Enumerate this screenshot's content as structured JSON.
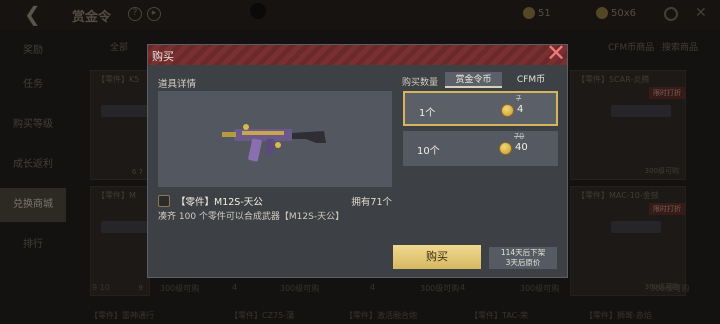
{
  "topbar": {
    "title": "赏金令",
    "currency1": "51",
    "currency2": "50x6"
  },
  "sidebar": {
    "items": [
      {
        "label": "奖励"
      },
      {
        "label": "任务"
      },
      {
        "label": "购买等级"
      },
      {
        "label": "成长返利"
      },
      {
        "label": "兑换商城"
      },
      {
        "label": "排行"
      }
    ]
  },
  "background": {
    "filters": [
      "全部",
      "CFM币商品",
      "搜索商品"
    ],
    "cards": [
      {
        "title": "【零件】K5",
        "price": "6 7"
      },
      {
        "title": "【零件】SCAR-炎腾",
        "limit": "限时打折",
        "price": "300级可购"
      },
      {
        "title": "【零件】M",
        "price": "9"
      },
      {
        "title": "【零件】MAC-10-金鼓",
        "limit": "限时打折",
        "price": "300级可购"
      }
    ],
    "bottom": [
      "9 10",
      "300级可购",
      "4",
      "300级可购",
      "4",
      "300级可购",
      "4",
      "300级可购",
      "300级可购",
      "4"
    ],
    "bottom_names": [
      "【零件】雷神通行",
      "【零件】CZ75-蒲",
      "【零件】激活融合炮",
      "【零件】TAC-荣",
      "【零件】狮鹫-赤焰"
    ]
  },
  "modal": {
    "title": "购买",
    "section_label": "道具详情",
    "item_name": "【零件】M12S-天公",
    "owned": "拥有71个",
    "description": "凑齐 100 个零件可以合成武器【M12S-天公】",
    "qty_label": "购买数量",
    "tabs": [
      {
        "label": "赏金令币",
        "selected": true
      },
      {
        "label": "CFM币",
        "selected": false
      }
    ],
    "options": [
      {
        "qty": "1个",
        "old_price": "7",
        "price": "4",
        "selected": true
      },
      {
        "qty": "10个",
        "old_price": "70",
        "price": "40",
        "selected": false
      }
    ],
    "buy_label": "购买",
    "expiry_line1": "114天后下架",
    "expiry_line2": "3天后原价"
  },
  "colors": {
    "accent_gold": "#d6b65a",
    "header_red": "#6a2a2a",
    "buy_button": "#e6cc7a"
  }
}
